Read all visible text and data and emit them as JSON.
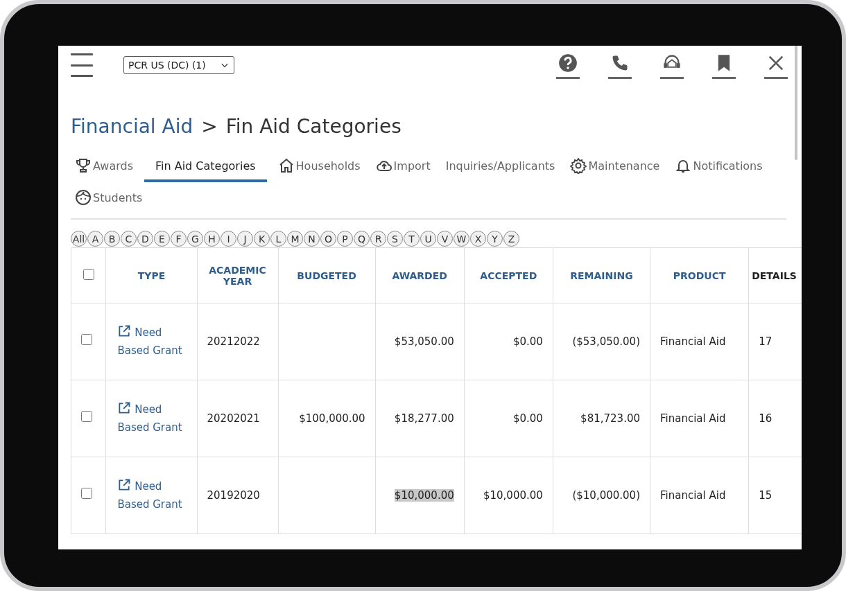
{
  "header": {
    "selector": "PCR US (DC) (1)"
  },
  "breadcrumb": {
    "parent": "Financial Aid",
    "separator": ">",
    "current": "Fin Aid Categories"
  },
  "tabs": [
    {
      "label": "Awards",
      "kind": "trophy",
      "selected": false
    },
    {
      "label": "Fin Aid Categories",
      "kind": "plain",
      "selected": true
    },
    {
      "label": "Households",
      "kind": "house",
      "selected": false
    },
    {
      "label": "Import",
      "kind": "cloud",
      "selected": false
    },
    {
      "label": "Inquiries/Applicants",
      "kind": "plain",
      "selected": false
    },
    {
      "label": "Maintenance",
      "kind": "gear",
      "selected": false
    },
    {
      "label": "Notifications",
      "kind": "bell",
      "selected": false
    },
    {
      "label": "Students",
      "kind": "face",
      "selected": false
    }
  ],
  "letters": [
    "All",
    "A",
    "B",
    "C",
    "D",
    "E",
    "F",
    "G",
    "H",
    "I",
    "J",
    "K",
    "L",
    "M",
    "N",
    "O",
    "P",
    "Q",
    "R",
    "S",
    "T",
    "U",
    "V",
    "W",
    "X",
    "Y",
    "Z"
  ],
  "table": {
    "select_all_checked": false,
    "columns": [
      "TYPE",
      "ACADEMIC YEAR",
      "BUDGETED",
      "AWARDED",
      "ACCEPTED",
      "REMAINING",
      "PRODUCT",
      "DETAILS"
    ],
    "rows": [
      {
        "checked": false,
        "type": "Need Based Grant",
        "year": "20212022",
        "budgeted": "",
        "awarded": "$53,050.00",
        "awarded_highlighted": false,
        "accepted": "$0.00",
        "remaining": "($53,050.00)",
        "product": "Financial Aid",
        "details": "17"
      },
      {
        "checked": false,
        "type": "Need Based Grant",
        "year": "20202021",
        "budgeted": "$100,000.00",
        "awarded": "$18,277.00",
        "awarded_highlighted": false,
        "accepted": "$0.00",
        "remaining": "$81,723.00",
        "product": "Financial Aid",
        "details": "16"
      },
      {
        "checked": false,
        "type": "Need Based Grant",
        "year": "20192020",
        "budgeted": "",
        "awarded": "$10,000.00",
        "awarded_highlighted": true,
        "accepted": "$10,000.00",
        "remaining": "($10,000.00)",
        "product": "Financial Aid",
        "details": "15"
      }
    ]
  }
}
